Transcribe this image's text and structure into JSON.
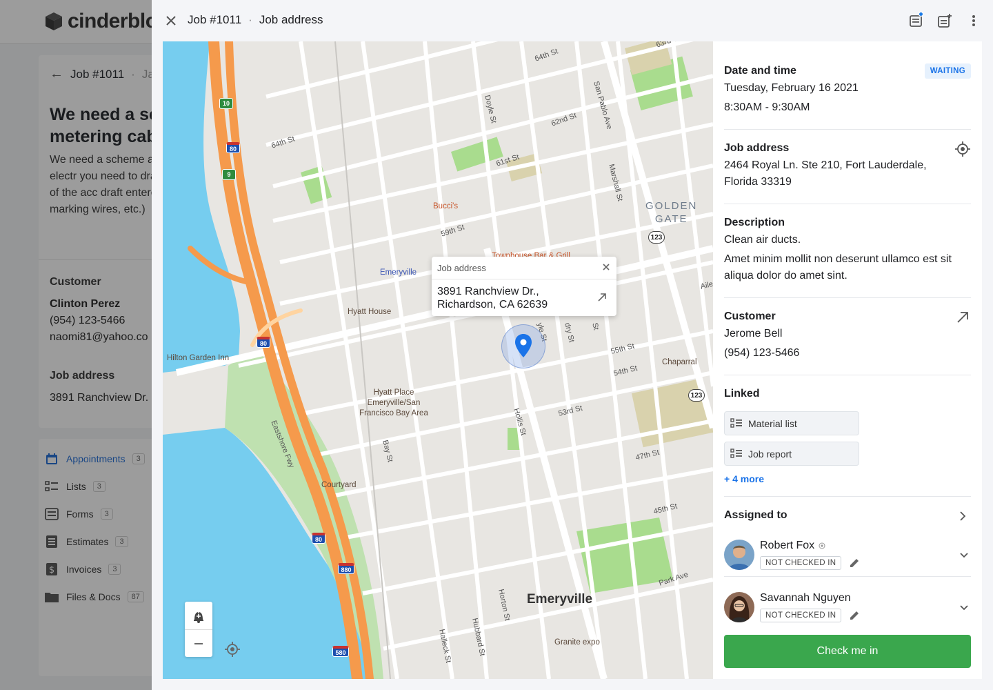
{
  "background_app": {
    "logo_text": "cinderbloc",
    "job_crumb": "Job #1011",
    "job_crumb_suffix": "Ja",
    "title": "We need a sc metering cab",
    "description": "We need a scheme accounting of electr you need to draw a adoption of the acc draft entered the ca marking wires, etc.)",
    "customer_label": "Customer",
    "customer_name": "Clinton Perez",
    "customer_phone": "(954) 123-5466",
    "customer_email": "naomi81@yahoo.co",
    "job_address_label": "Job address",
    "job_address_value": "3891 Ranchview Dr.",
    "nav": [
      {
        "label": "Appointments",
        "count": "3",
        "icon": "calendar-icon"
      },
      {
        "label": "Lists",
        "count": "3",
        "icon": "checklist-icon"
      },
      {
        "label": "Forms",
        "count": "3",
        "icon": "form-icon"
      },
      {
        "label": "Estimates",
        "count": "3",
        "icon": "estimate-icon"
      },
      {
        "label": "Invoices",
        "count": "3",
        "icon": "invoice-icon"
      },
      {
        "label": "Files & Docs",
        "count": "87",
        "icon": "folder-icon"
      }
    ]
  },
  "modal": {
    "crumb_job": "Job #1011",
    "crumb_sep": "·",
    "crumb_page": "Job address",
    "header_icons": [
      "notes-icon",
      "add-note-icon",
      "more-vertical-icon"
    ]
  },
  "map": {
    "popup": {
      "title": "Job address",
      "address_line1": "3891 Ranchview Dr.,",
      "address_line2": "Richardson, CA 62639"
    },
    "labels": {
      "city": "Emeryville",
      "district_1": "GOLDEN",
      "district_2": "GATE",
      "poi_buccis": "Bucci's",
      "poi_townhouse": "Townhouse Bar & Grill",
      "poi_emeryville_station": "Emeryville",
      "poi_hyatt_house": "Hyatt House",
      "poi_hilton": "Hilton Garden Inn",
      "poi_hyatt_place": "Hyatt Place Emeryville/San Francisco Bay Area",
      "poi_courtyard": "Courtyard",
      "poi_chaparral": "Chaparral",
      "poi_granite": "Granite expo",
      "st_64_top": "64th St",
      "st_63rd": "63rd St",
      "st_64_left": "64th St",
      "st_62nd": "62nd St",
      "st_61st": "61st St",
      "st_59th": "59th St",
      "st_55th": "55th St",
      "st_54th": "54th St",
      "st_53rd": "53rd St",
      "st_47th": "47th St",
      "st_45th": "45th St",
      "st_doyle": "Doyle St",
      "st_sanpablo": "San Pablo Ave",
      "st_marshall": "Marshall St",
      "st_hollis": "Hollis St",
      "st_bay": "Bay St",
      "st_eastshore": "Eastshore Fwy",
      "st_horton": "Horton St",
      "st_hubbard": "Hubbard St",
      "st_halleck": "Halleck St",
      "st_park": "Park Ave",
      "st_aile": "Aile",
      "st_doyle2": "yle St",
      "st_dry": "dry St",
      "st_st": "St",
      "shield_123a": "123",
      "shield_123b": "123",
      "hwy_10": "10",
      "hwy_9": "9",
      "i80_a": "80",
      "i80_b": "80",
      "i80_c": "80",
      "i880": "880",
      "i580": "580"
    }
  },
  "panel": {
    "date_title": "Date and time",
    "status": "WAITING",
    "date_value": "Tuesday, February 16 2021",
    "time_value": "8:30AM - 9:30AM",
    "address_title": "Job address",
    "address_line1": "2464 Royal Ln. Ste 210, Fort Lauderdale,",
    "address_line2": "Florida 33319",
    "description_title": "Description",
    "description_line1": "Clean air ducts.",
    "description_line2": "Amet minim mollit non deserunt ullamco est sit aliqua dolor do amet sint.",
    "customer_title": "Customer",
    "customer_name": "Jerome Bell",
    "customer_phone": "(954) 123-5466",
    "linked_title": "Linked",
    "linked_items": [
      "Material list",
      "Job report"
    ],
    "linked_more": "+ 4 more",
    "assigned_title": "Assigned to",
    "assignees": [
      {
        "name": "Robert Fox",
        "status": "NOT CHECKED IN"
      },
      {
        "name": "Savannah Nguyen",
        "status": "NOT CHECKED IN"
      }
    ],
    "checkin_label": "Check me in"
  },
  "colors": {
    "accent": "#1a73e8",
    "checkin_green": "#3aa74d",
    "waiting_bg": "#e6f1fd",
    "freeway": "#f59a4c",
    "water": "#76cdef",
    "park": "#a9dc8e"
  }
}
